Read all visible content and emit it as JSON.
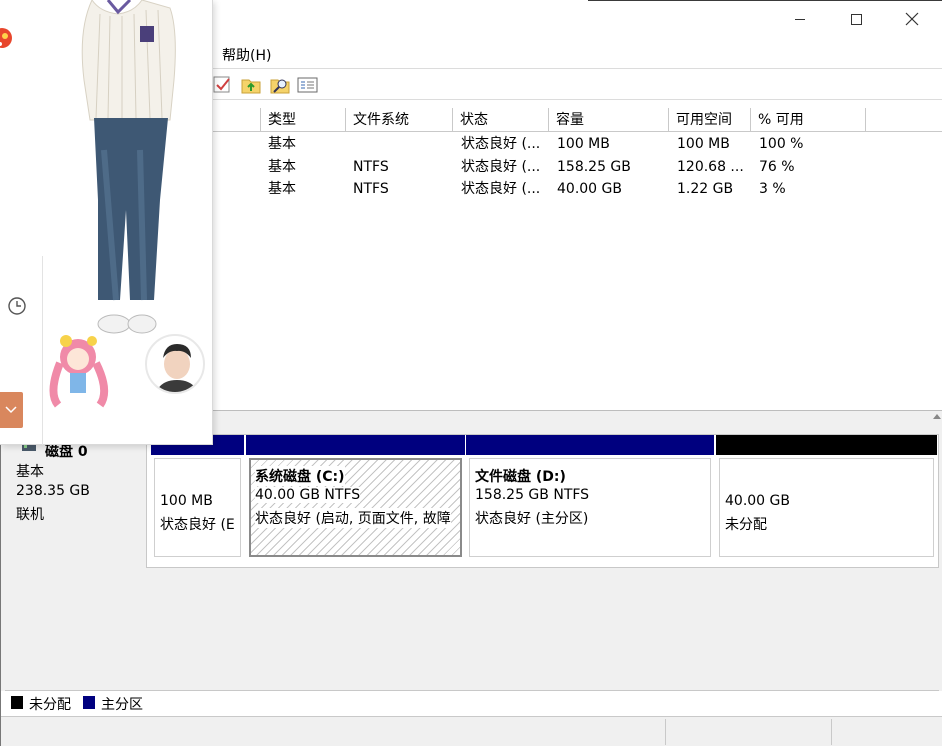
{
  "menubar": {
    "help_label": "帮助(H)"
  },
  "toolbar": {
    "icons": [
      "check-icon",
      "upload-folder-icon",
      "search-folder-icon",
      "properties-icon"
    ]
  },
  "volume_list": {
    "headers": [
      "类型",
      "文件系统",
      "状态",
      "容量",
      "可用空间",
      "% 可用"
    ],
    "rows": [
      {
        "type": "基本",
        "fs": "",
        "status": "状态良好 (...",
        "capacity": "100 MB",
        "free": "100 MB",
        "pct": "100 %"
      },
      {
        "type": "基本",
        "fs": "NTFS",
        "status": "状态良好 (...",
        "capacity": "158.25 GB",
        "free": "120.68 ...",
        "pct": "76 %"
      },
      {
        "type": "基本",
        "fs": "NTFS",
        "status": "状态良好 (...",
        "capacity": "40.00 GB",
        "free": "1.22 GB",
        "pct": "3 %"
      }
    ]
  },
  "disk": {
    "name": "磁盘 0",
    "type": "基本",
    "size": "238.35 GB",
    "state": "联机",
    "partitions": [
      {
        "title": "",
        "size": "100 MB",
        "status": "状态良好 (E",
        "bar_color": "#00007f"
      },
      {
        "title": "系统磁盘  (C:)",
        "size": "40.00 GB NTFS",
        "status": "状态良好 (启动, 页面文件, 故障",
        "bar_color": "#00007f"
      },
      {
        "title": "文件磁盘  (D:)",
        "size": "158.25 GB NTFS",
        "status": "状态良好 (主分区)",
        "bar_color": "#00007f"
      },
      {
        "title": "",
        "size": "40.00 GB",
        "status": "未分配",
        "bar_color": "#000000"
      }
    ]
  },
  "legend": [
    {
      "label": "未分配",
      "color": "#000000"
    },
    {
      "label": "主分区",
      "color": "#00007f"
    }
  ],
  "window_controls": {
    "minimize": "minimize-icon",
    "maximize": "maximize-icon",
    "close": "close-icon"
  },
  "overlay": {
    "accent": "#d9875d"
  }
}
